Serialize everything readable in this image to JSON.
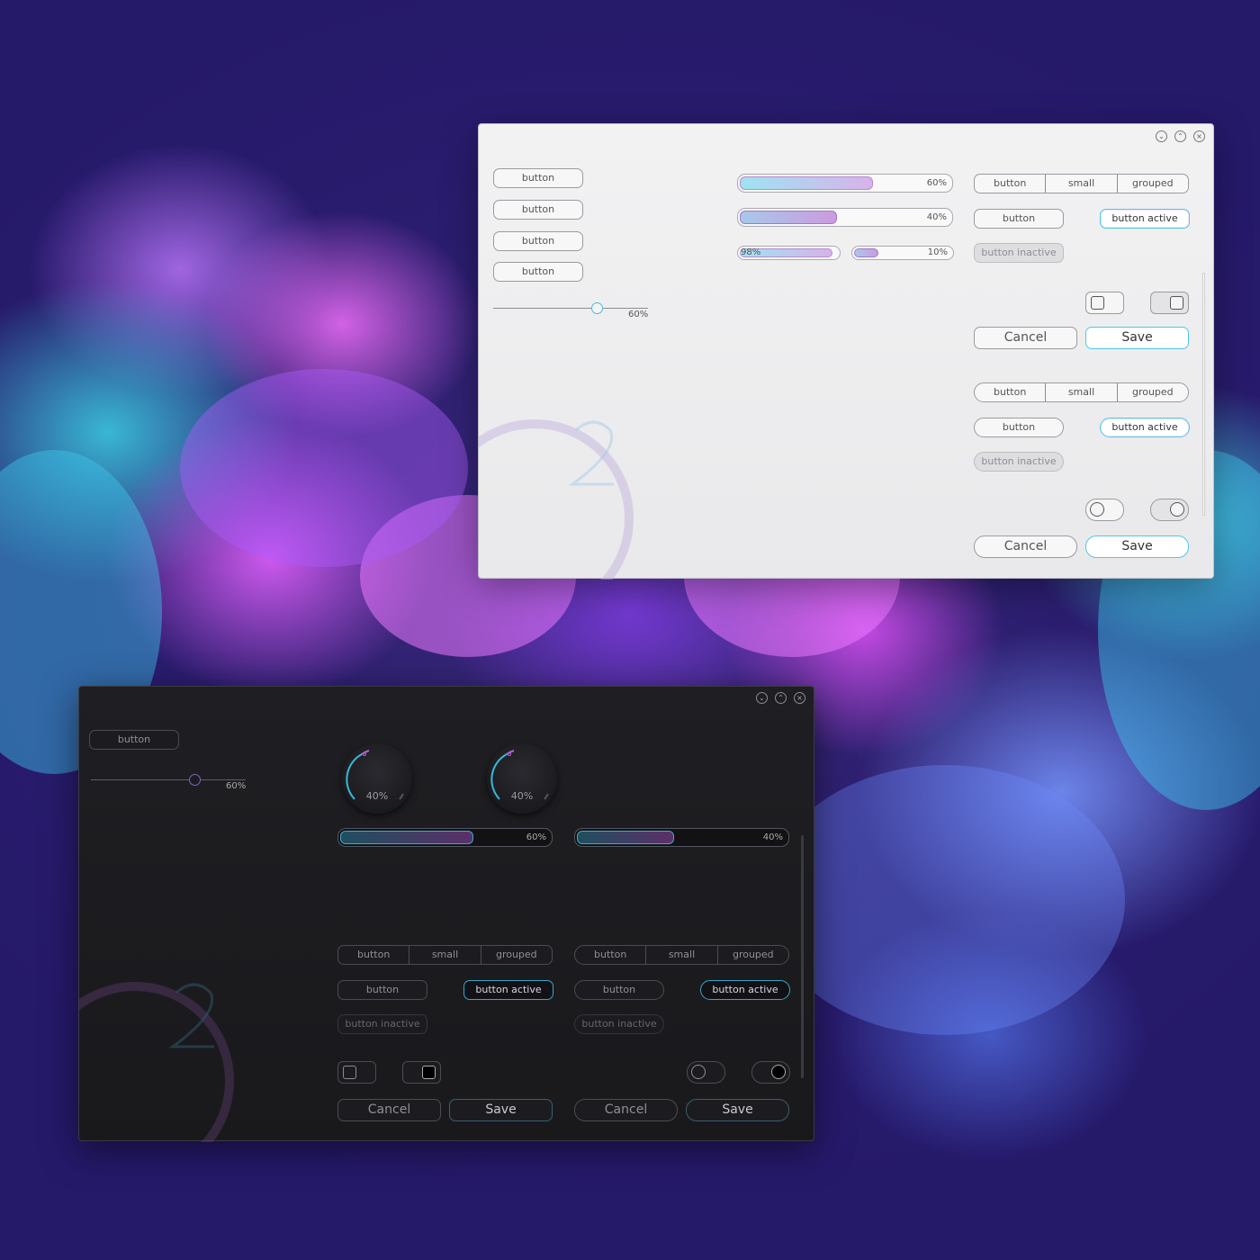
{
  "colors": {
    "accent_cyan": "#4ec8e6",
    "accent_magenta": "#c86ad9",
    "light_bg": "#eeeeef",
    "dark_bg": "#1c1c1f",
    "wallpaper": "#2a1c6e"
  },
  "window_controls": {
    "minimize_icon": "chevron-down-icon",
    "maximize_icon": "chevron-up-icon",
    "close_icon": "close-icon"
  },
  "light": {
    "buttons": [
      "button",
      "button",
      "button",
      "button"
    ],
    "slider": {
      "label": "60%",
      "value": 0.6
    },
    "progress": [
      {
        "label": "60%",
        "value": 0.6
      },
      {
        "label": "40%",
        "value": 0.4
      },
      {
        "label": "98%",
        "value": 0.98
      },
      {
        "label": "10%",
        "value": 0.1
      }
    ],
    "group_square": [
      "button",
      "small",
      "grouped"
    ],
    "group_round": [
      "button",
      "small",
      "grouped"
    ],
    "button": "button",
    "button_active": "button active",
    "button_inactive": "button inactive",
    "cancel": "Cancel",
    "save": "Save"
  },
  "dark": {
    "button": "button",
    "slider": {
      "label": "60%",
      "value": 0.6
    },
    "knobs": [
      {
        "label": "40%",
        "value": 0.4
      },
      {
        "label": "40%",
        "value": 0.4
      }
    ],
    "progress": [
      {
        "label": "60%",
        "value": 0.6
      },
      {
        "label": "40%",
        "value": 0.4
      }
    ],
    "group_square": [
      "button",
      "small",
      "grouped"
    ],
    "group_round": [
      "button",
      "small",
      "grouped"
    ],
    "button_label": "button",
    "button_active": "button active",
    "button_inactive": "button inactive",
    "cancel": "Cancel",
    "save": "Save"
  }
}
